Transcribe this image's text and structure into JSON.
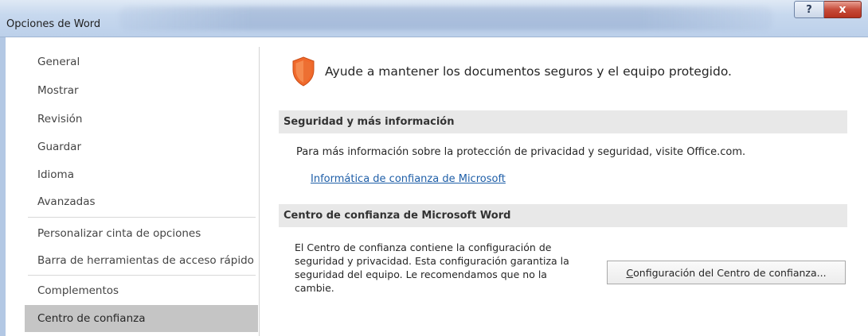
{
  "window": {
    "title": "Opciones de Word",
    "help_label": "?",
    "close_label": "x"
  },
  "sidebar": {
    "items": [
      {
        "label": "General"
      },
      {
        "label": "Mostrar"
      },
      {
        "label": "Revisión"
      },
      {
        "label": "Guardar"
      },
      {
        "label": "Idioma"
      },
      {
        "label": "Avanzadas"
      },
      {
        "label": "Personalizar cinta de opciones"
      },
      {
        "label": "Barra de herramientas de acceso rápido"
      },
      {
        "label": "Complementos"
      },
      {
        "label": "Centro de confianza"
      }
    ],
    "selected_index": 9
  },
  "main": {
    "header": "Ayude a mantener los documentos seguros y el equipo protegido.",
    "security_section": {
      "title": "Seguridad y más información",
      "text": "Para más información sobre la protección de privacidad y seguridad, visite Office.com.",
      "link": "Informática de confianza de Microsoft"
    },
    "trust_section": {
      "title": "Centro de confianza de Microsoft Word",
      "description": "El Centro de confianza contiene la configuración de seguridad y privacidad. Esta configuración garantiza la seguridad del equipo. Le recomendamos que no la cambie.",
      "button_accesskey": "C",
      "button_rest": "onfiguración del Centro de confianza..."
    }
  },
  "colors": {
    "shield": "#f0692b",
    "link": "#1f5fa8",
    "selected_bg": "#c5c5c5",
    "section_bg": "#e8e8e8"
  }
}
